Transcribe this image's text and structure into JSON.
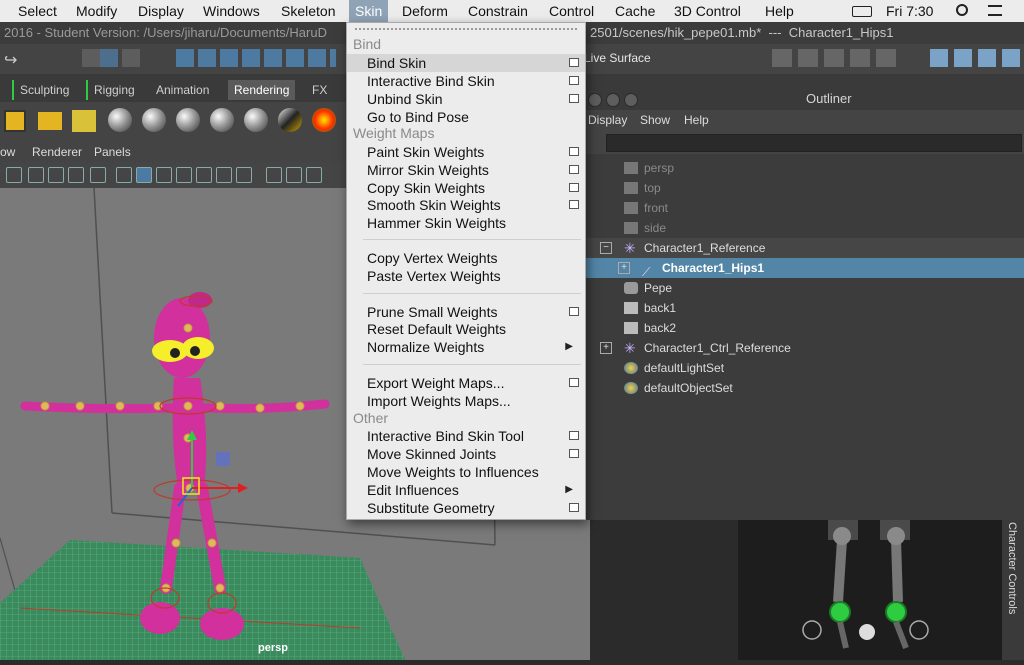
{
  "mac_menubar": {
    "items": [
      "Select",
      "Modify",
      "Display",
      "Windows",
      "Skeleton",
      "Skin",
      "Deform",
      "Constrain",
      "Control",
      "Cache",
      "3D Control",
      "Help"
    ],
    "active": "Skin",
    "clock": "Fri 7:30"
  },
  "title_bar": {
    "left_text": "2016 - Student Version: /Users/jiharu/Documents/HaruD",
    "right_text": "2501/scenes/hik_pepe01.mb*  ---  Character1_Hips1"
  },
  "toolbar": {
    "live_surface_label": "Live Surface"
  },
  "shelf_tabs": {
    "items": [
      "Sculpting",
      "Rigging",
      "Animation",
      "Rendering",
      "FX"
    ],
    "active": "Rendering"
  },
  "viewport_menu": {
    "items": [
      "ow",
      "Renderer",
      "Panels"
    ]
  },
  "viewport": {
    "camera_label": "persp"
  },
  "skin_menu": {
    "sections": {
      "bind": "Bind",
      "weight_maps": "Weight Maps",
      "other": "Other"
    },
    "items": {
      "bind_skin": "Bind Skin",
      "interactive_bind_skin": "Interactive Bind Skin",
      "unbind_skin": "Unbind Skin",
      "go_to_bind_pose": "Go to Bind Pose",
      "paint_skin_weights": "Paint Skin Weights",
      "mirror_skin_weights": "Mirror Skin Weights",
      "copy_skin_weights": "Copy Skin Weights",
      "smooth_skin_weights": "Smooth Skin Weights",
      "hammer_skin_weights": "Hammer Skin Weights",
      "copy_vertex_weights": "Copy Vertex Weights",
      "paste_vertex_weights": "Paste Vertex Weights",
      "prune_small_weights": "Prune Small Weights",
      "reset_default_weights": "Reset Default Weights",
      "normalize_weights": "Normalize Weights",
      "export_weight_maps": "Export Weight Maps...",
      "import_weights_maps": "Import Weights Maps...",
      "interactive_bind_skin_tool": "Interactive Bind Skin Tool",
      "move_skinned_joints": "Move Skinned Joints",
      "move_weights_to_influences": "Move Weights to Influences",
      "edit_influences": "Edit Influences",
      "substitute_geometry": "Substitute Geometry"
    }
  },
  "outliner": {
    "title": "Outliner",
    "menu": [
      "Display",
      "Show",
      "Help"
    ],
    "rows": {
      "persp": "persp",
      "top": "top",
      "front": "front",
      "side": "side",
      "character1_reference": "Character1_Reference",
      "character1_hips1": "Character1_Hips1",
      "pepe": "Pepe",
      "back1": "back1",
      "back2": "back2",
      "character1_ctrl_reference": "Character1_Ctrl_Reference",
      "default_light_set": "defaultLightSet",
      "default_object_set": "defaultObjectSet"
    }
  },
  "character_controls": {
    "tab_label": "Character Controls"
  },
  "colors": {
    "menu_highlight": "#8fa3b6",
    "outliner_selection": "#5285a6",
    "character_pink": "#d2309c",
    "effector_green": "#2ecc40"
  }
}
